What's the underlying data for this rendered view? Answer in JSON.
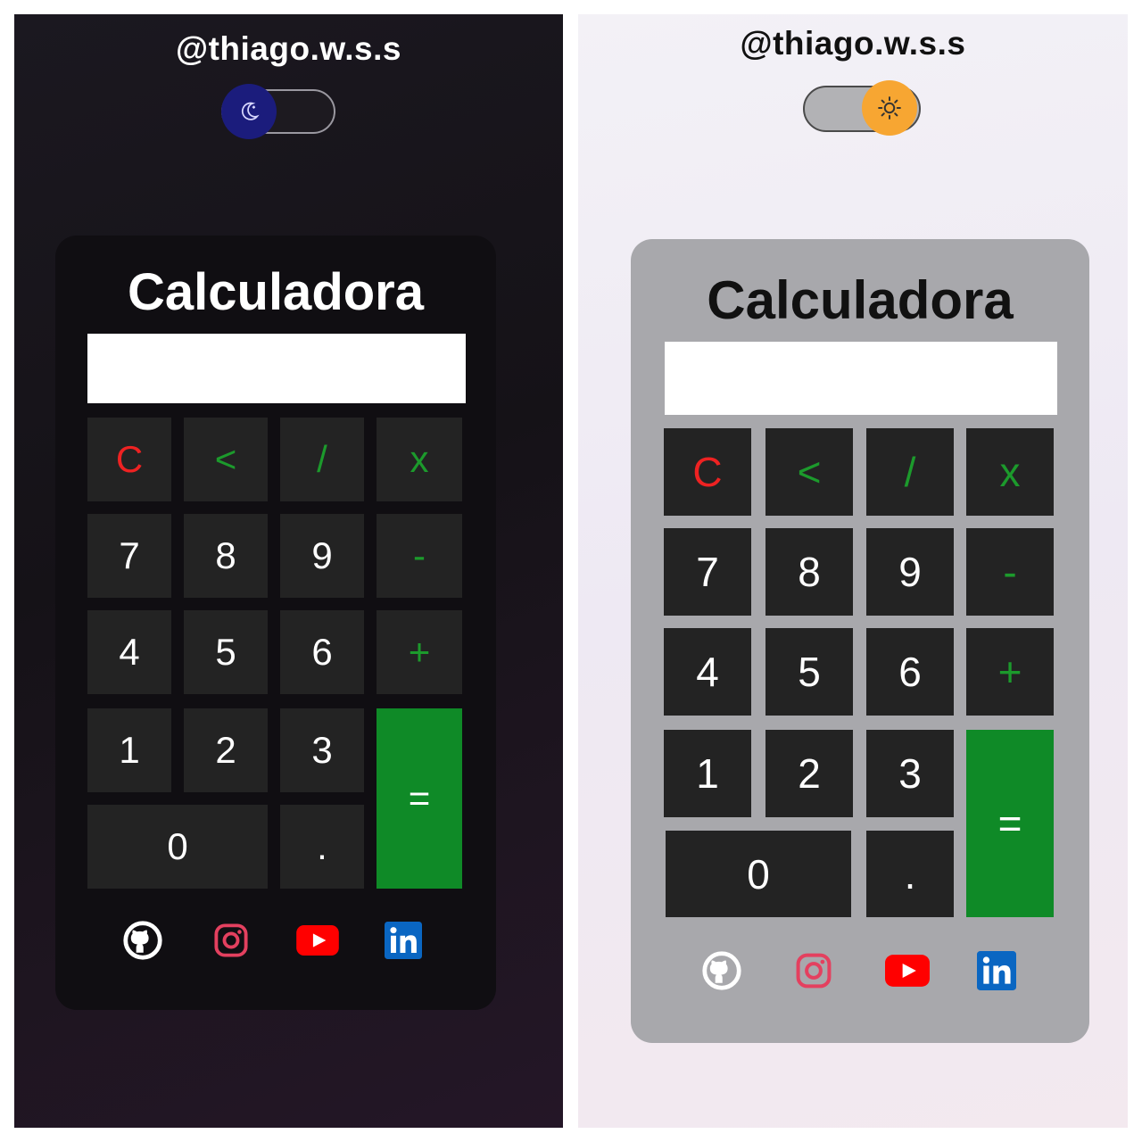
{
  "screens": {
    "dark": {
      "theme_name": "dark",
      "handle": "@thiago.w.s.s",
      "toggle_icon": "moon-icon",
      "title": "Calculadora",
      "display_value": ""
    },
    "light": {
      "theme_name": "light",
      "handle": "@thiago.w.s.s",
      "toggle_icon": "sun-icon",
      "title": "Calculadora",
      "display_value": ""
    }
  },
  "keys": {
    "clear": "C",
    "backspace": "<",
    "divide": "/",
    "multiply": "x",
    "seven": "7",
    "eight": "8",
    "nine": "9",
    "minus": "-",
    "four": "4",
    "five": "5",
    "six": "6",
    "plus": "+",
    "one": "1",
    "two": "2",
    "three": "3",
    "equals": "=",
    "zero": "0",
    "decimal": "."
  },
  "social_links": [
    "github-icon",
    "instagram-icon",
    "youtube-icon",
    "linkedin-icon"
  ],
  "colors": {
    "accent_green": "#0f8a27",
    "operator_green": "#1c9a2c",
    "clear_red": "#ee2222",
    "key_background": "#232323",
    "dark_card": "#100e12",
    "light_card": "#a8a8ac",
    "moon_knob": "#1b1c7c",
    "sun_knob": "#f7a632",
    "youtube_red": "#ff0000",
    "linkedin_blue": "#0a66c2",
    "instagram_pink": "#e4405f"
  }
}
